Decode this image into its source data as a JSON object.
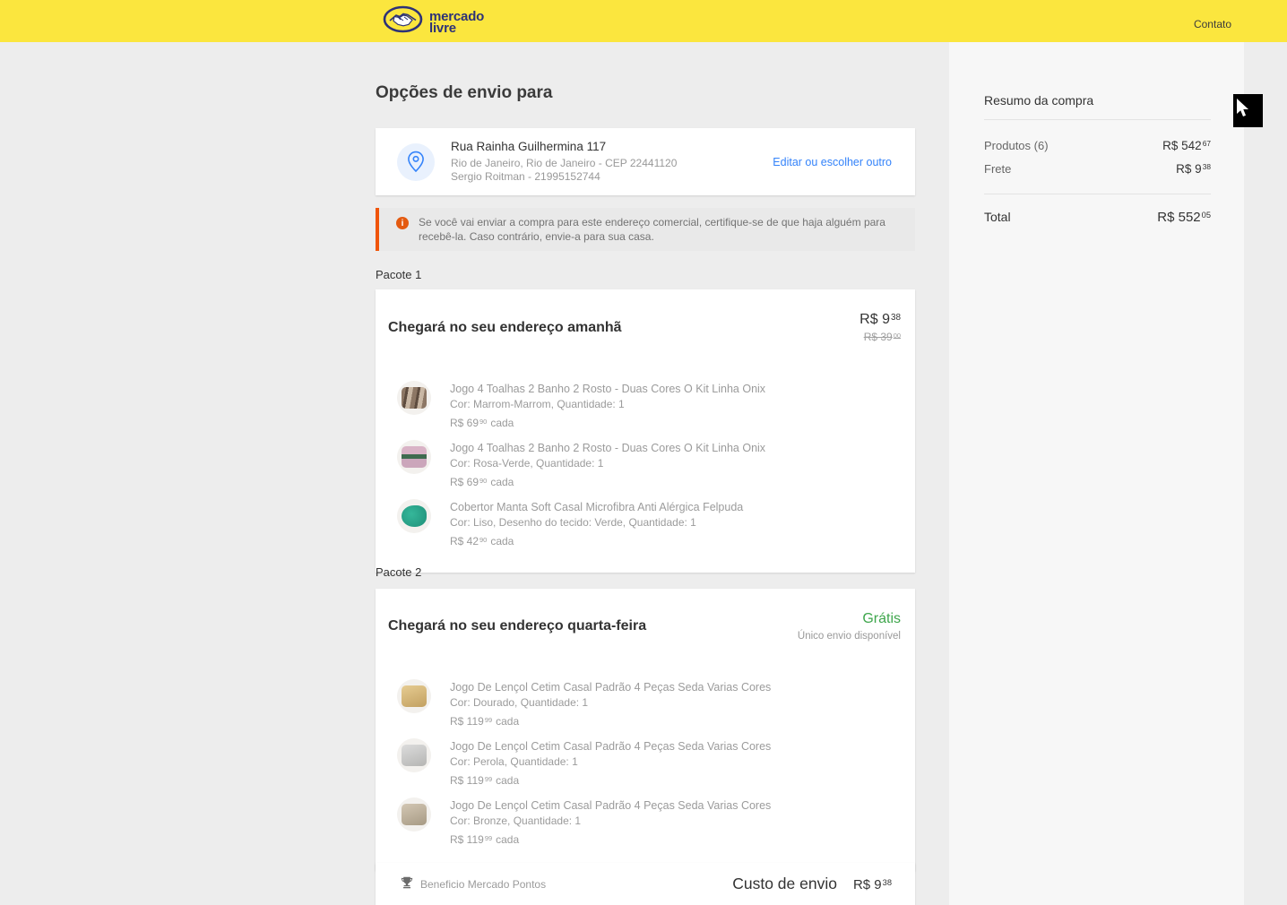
{
  "header": {
    "brand_line1": "mercado",
    "brand_line2": "livre",
    "contato": "Contato"
  },
  "page": {
    "title": "Opções de envio para"
  },
  "address": {
    "line1": "Rua Rainha Guilhermina 117",
    "line2": "Rio de Janeiro, Rio de Janeiro - CEP 22441120",
    "line3": "Sergio Roitman - 21995152744",
    "edit_link": "Editar ou escolher outro"
  },
  "notice": {
    "text": "Se você vai enviar a compra para este endereço comercial, certifique-se de que haja alguém para recebê-la. Caso contrário, envie-a para sua casa."
  },
  "packages": [
    {
      "label": "Pacote 1",
      "title": "Chegará no seu endereço amanhã",
      "price_int": "R$ 9",
      "price_cents": "38",
      "old_int": "R$ 39",
      "old_cents": "00",
      "items": [
        {
          "title": "Jogo 4 Toalhas 2 Banho 2 Rosto - Duas Cores O Kit Linha Onix",
          "attrs": "Cor: Marrom-Marrom, Quantidade: 1",
          "price_int": "R$ 69",
          "price_cents": "90",
          "price_suffix": "cada",
          "image": "brown-towels"
        },
        {
          "title": "Jogo 4 Toalhas 2 Banho 2 Rosto - Duas Cores O Kit Linha Onix",
          "attrs": "Cor: Rosa-Verde, Quantidade: 1",
          "price_int": "R$ 69",
          "price_cents": "90",
          "price_suffix": "cada",
          "image": "pink-green-towels"
        },
        {
          "title": "Cobertor Manta Soft Casal Microfibra Anti Alérgica Felpuda",
          "attrs": "Cor: Liso, Desenho do tecido: Verde, Quantidade: 1",
          "price_int": "R$ 42",
          "price_cents": "90",
          "price_suffix": "cada",
          "image": "teal-blanket"
        }
      ]
    },
    {
      "label": "Pacote 2",
      "title": "Chegará no seu endereço quarta-feira",
      "free_label": "Grátis",
      "free_note": "Único envio disponível",
      "items": [
        {
          "title": "Jogo De Lençol Cetim Casal Padrão 4 Peças Seda Varias Cores",
          "attrs": "Cor: Dourado, Quantidade: 1",
          "price_int": "R$ 119",
          "price_cents": "99",
          "price_suffix": "cada",
          "image": "gold-sheets"
        },
        {
          "title": "Jogo De Lençol Cetim Casal Padrão 4 Peças Seda Varias Cores",
          "attrs": "Cor: Perola, Quantidade: 1",
          "price_int": "R$ 119",
          "price_cents": "99",
          "price_suffix": "cada",
          "image": "pearl-sheets"
        },
        {
          "title": "Jogo De Lençol Cetim Casal Padrão 4 Peças Seda Varias Cores",
          "attrs": "Cor: Bronze, Quantidade: 1",
          "price_int": "R$ 119",
          "price_cents": "99",
          "price_suffix": "cada",
          "image": "bronze-sheets"
        }
      ]
    }
  ],
  "footer_bar": {
    "benefit": "Beneficio Mercado Pontos",
    "cost_label": "Custo de envio",
    "cost_int": "R$ 9",
    "cost_cents": "38"
  },
  "summary": {
    "title": "Resumo da compra",
    "rows": [
      {
        "label": "Produtos (6)",
        "value_int": "R$ 542",
        "value_cents": "67"
      },
      {
        "label": "Frete",
        "value_int": "R$ 9",
        "value_cents": "38"
      }
    ],
    "total_label": "Total",
    "total_int": "R$ 552",
    "total_cents": "05"
  },
  "icons": {
    "logo": "handshake-in-oval",
    "address": "location-pin",
    "notice": "info-circle",
    "benefit": "trophy",
    "overlay": "mouse-cursor"
  },
  "colors": {
    "header_bg": "#fbe63e",
    "brand_navy": "#2d3277",
    "link_blue": "#3483fa",
    "notice_orange": "#f0550a",
    "free_green": "#3ea64c",
    "page_bg": "#ededed",
    "panel_bg": "#f7f7f7"
  }
}
